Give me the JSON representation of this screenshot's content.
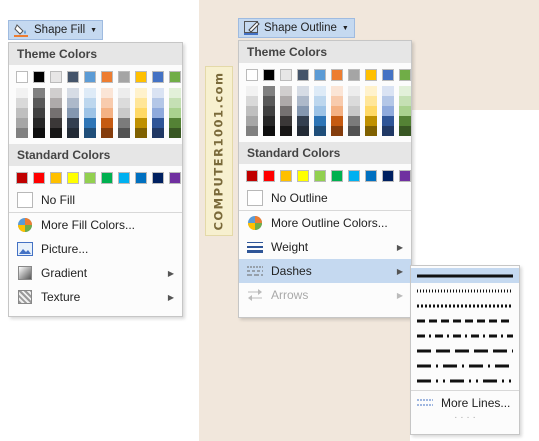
{
  "colors": {
    "ribbon_highlight": "#c5d9f0",
    "theme_top": [
      "#ffffff",
      "#000000",
      "#e7e6e6",
      "#44546a",
      "#5b9bd5",
      "#ed7d31",
      "#a5a5a5",
      "#ffc000",
      "#4472c4",
      "#70ad47"
    ],
    "theme_shades": [
      [
        "#f2f2f2",
        "#d9d9d9",
        "#bfbfbf",
        "#a6a6a6",
        "#808080"
      ],
      [
        "#808080",
        "#595959",
        "#404040",
        "#262626",
        "#0d0d0d"
      ],
      [
        "#d0cece",
        "#aeaaaa",
        "#757171",
        "#3b3838",
        "#171616"
      ],
      [
        "#d6dce5",
        "#adb9ca",
        "#8497b0",
        "#333f50",
        "#222a35"
      ],
      [
        "#deebf7",
        "#bdd7ee",
        "#9dc3e6",
        "#2e75b6",
        "#1f4e79"
      ],
      [
        "#fbe5d6",
        "#f8cbad",
        "#f4b183",
        "#c55a11",
        "#843c0c"
      ],
      [
        "#ededed",
        "#dbdbdb",
        "#c9c9c9",
        "#7b7b7b",
        "#525252"
      ],
      [
        "#fff2cc",
        "#ffe699",
        "#ffd966",
        "#bf9000",
        "#7f6000"
      ],
      [
        "#dae3f3",
        "#b4c7e7",
        "#8faadc",
        "#2f5597",
        "#203864"
      ],
      [
        "#e2f0d9",
        "#c5e0b4",
        "#a9d18e",
        "#548235",
        "#385723"
      ]
    ],
    "standard": [
      "#c00000",
      "#ff0000",
      "#ffc000",
      "#ffff00",
      "#92d050",
      "#00b050",
      "#00b0f0",
      "#0070c0",
      "#002060",
      "#7030a0"
    ]
  },
  "left": {
    "button_label": "Shape Fill",
    "theme_header": "Theme Colors",
    "standard_header": "Standard Colors",
    "no_fill": "No Fill",
    "more_colors": "More Fill Colors...",
    "picture": "Picture...",
    "gradient": "Gradient",
    "texture": "Texture"
  },
  "right": {
    "button_label": "Shape Outline",
    "theme_header": "Theme Colors",
    "standard_header": "Standard Colors",
    "no_outline": "No Outline",
    "more_colors": "More Outline Colors...",
    "weight": "Weight",
    "dashes": "Dashes",
    "arrows": "Arrows"
  },
  "dashes_menu": {
    "more_lines": "More Lines...",
    "styles": [
      "solid",
      "round-dot",
      "square-dot",
      "dash",
      "dash-dot",
      "long-dash",
      "long-dash-dot",
      "long-dash-dot-dot"
    ]
  },
  "watermark": "COMPUTER1001.com"
}
